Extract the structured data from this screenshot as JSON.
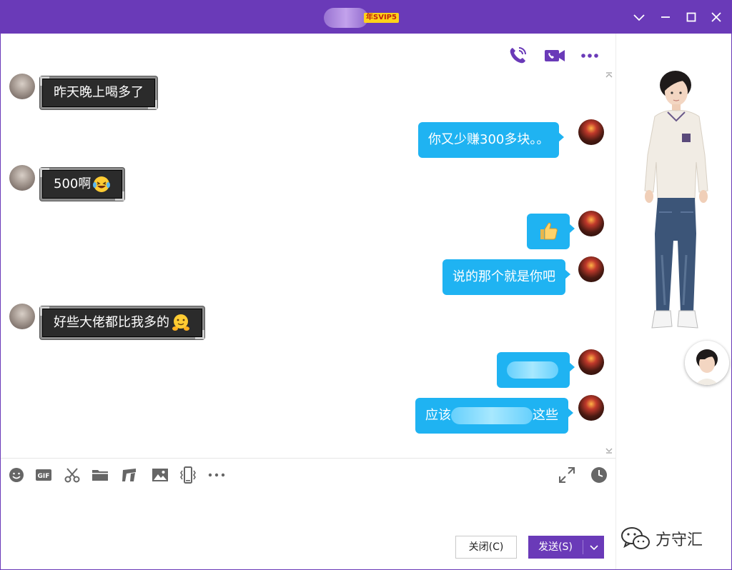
{
  "window": {
    "title_vip_badge": "年SVIP5",
    "colors": {
      "titlebar": "#6a3ab8",
      "accent": "#6a3ab8",
      "bubble_self": "#1fb3f2",
      "bubble_other": "#2b2b2b"
    }
  },
  "toolbar": {
    "icons": [
      "voice-call-icon",
      "video-call-icon",
      "more-options-icon"
    ]
  },
  "messages": [
    {
      "side": "left",
      "text": "昨天晚上喝多了"
    },
    {
      "side": "right",
      "text": "你又少赚300多块。。"
    },
    {
      "side": "left",
      "text": "500啊",
      "emoji": "laughing-tears-emoji"
    },
    {
      "side": "right",
      "text": "",
      "emoji": "thumbs-up-emoji"
    },
    {
      "side": "right",
      "text": "说的那个就是你吧"
    },
    {
      "side": "left",
      "text": "好些大佬都比我多的",
      "emoji": "hugging-face-emoji"
    },
    {
      "side": "right",
      "text": "",
      "note": "blurred content"
    },
    {
      "side": "right",
      "text_prefix": "应该",
      "text_suffix": "这些"
    }
  ],
  "input_toolbar": {
    "icons": [
      "emoji-icon",
      "gif-icon",
      "screenshot-scissors-icon",
      "folder-icon",
      "music-icon",
      "image-icon",
      "shake-icon",
      "more-icon",
      "expand-icon",
      "history-clock-icon"
    ]
  },
  "buttons": {
    "close_label": "关闭(C)",
    "send_label": "发送(S)"
  },
  "watermark": {
    "text": "方守汇"
  }
}
